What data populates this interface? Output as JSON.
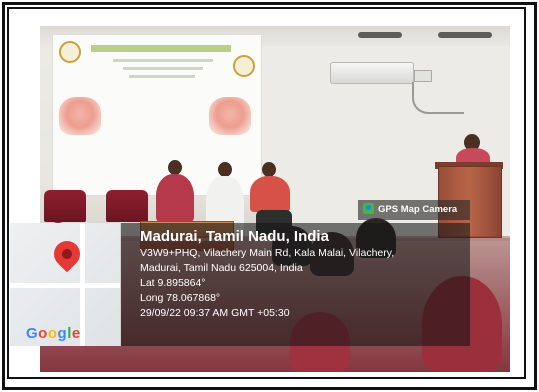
{
  "photo": {
    "description_colors": {
      "frame": "#111111",
      "overlay": "#141414",
      "pin": "#e53935"
    }
  },
  "tag": {
    "label": "GPS Map Camera"
  },
  "location": {
    "city": "Madurai, Tamil Nadu, India",
    "address_line1": "V3W9+PHQ, Vilachery Main Rd, Kala Malai, Vilachery,",
    "address_line2": "Madurai, Tamil Nadu 625004, India",
    "lat": "Lat 9.895864°",
    "long": "Long 78.067868°",
    "timestamp": "29/09/22 09:37 AM GMT +05:30"
  },
  "map": {
    "brand_letters": [
      "G",
      "o",
      "o",
      "g",
      "l",
      "e"
    ]
  }
}
